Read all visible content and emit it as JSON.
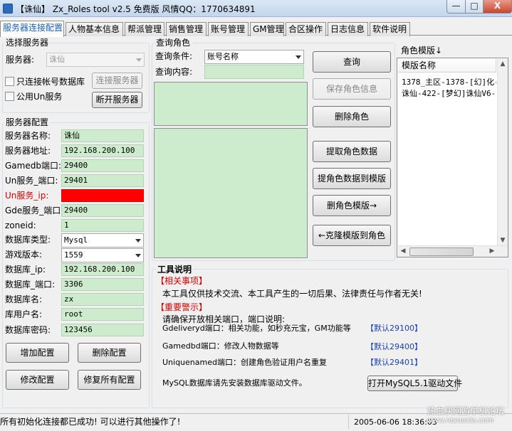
{
  "window": {
    "title": "【诛仙】 Zx_Roles tool v2.5 免费版 风情QQ：1770634891",
    "min": "—",
    "max": "□",
    "close": "X"
  },
  "tabs": [
    "服务器连接配置",
    "人物基本信息",
    "帮派管理",
    "销售管理",
    "账号管理",
    "GM管理",
    "合区操作",
    "日志信息",
    "软件说明"
  ],
  "server_select": {
    "group_label": "选择服务器",
    "server_label": "服务器:",
    "server_value": "诛仙",
    "only_account_db": "只连接帐号数据库",
    "public_un": "公用Un服务",
    "connect_button": "连接服务器",
    "disconnect_button": "断开服务器"
  },
  "server_config": {
    "group_label": "服务器配置",
    "fields": [
      {
        "label": "服务器名称:",
        "value": "诛仙"
      },
      {
        "label": "服务器地址:",
        "value": "192.168.200.100"
      },
      {
        "label": "Gamedb端口:",
        "value": "29400"
      },
      {
        "label": "Un服务_端口:",
        "value": "29401"
      },
      {
        "label": "Un服务_ip:",
        "value": ""
      },
      {
        "label": "Gde服务_端口:",
        "value": "29400"
      },
      {
        "label": "zoneid:",
        "value": "1"
      },
      {
        "label": "数据库类型:",
        "value": "Mysql"
      },
      {
        "label": "游戏版本:",
        "value": "1559"
      },
      {
        "label": "数据库_ip:",
        "value": "192.168.200.100"
      },
      {
        "label": "数据库_端口:",
        "value": "3306"
      },
      {
        "label": "数据库名:",
        "value": "zx"
      },
      {
        "label": "库用户名:",
        "value": "root"
      },
      {
        "label": "数据库密码:",
        "value": "123456"
      }
    ],
    "add_button": "增加配置",
    "delete_button": "删除配置",
    "modify_button": "修改配置",
    "restore_button": "修复所有配置"
  },
  "query": {
    "group_label": "查询角色",
    "condition_label": "查询条件:",
    "condition_value": "账号名称",
    "content_label": "查询内容:",
    "content_value": "",
    "query_button": "查询",
    "save_button": "保存角色信息",
    "delete_button": "删除角色",
    "extract_button": "提取角色数据",
    "to_template_button": "提角色数据到模版",
    "delete_template_button": "删角色模版→",
    "clone_button": "←克隆模版到角色"
  },
  "template": {
    "label": "角色模版↓",
    "column": "模版名称",
    "items": [
      "1378_主区-1378-[幻]化-1041",
      "诛仙-422-[梦幻]诛仙V6-2112"
    ]
  },
  "tool_info": {
    "title": "工具说明",
    "notice_title": "【相关事项】",
    "notice_text": "本工具仅供技术交流、本工具产生的一切后果、法律责任与作者无关!",
    "warning_title": "【重要警示】",
    "port_intro": "请确保开放相关端口，端口说明:",
    "port_lines": [
      {
        "text": "Gdeliveryd端口：相关功能，如秒充元宝，GM功能等",
        "default": "【默认29100】"
      },
      {
        "text": "Gamedbd端口：修改人物数据等",
        "default": "【默认29400】"
      },
      {
        "text": "Uniquenamed端口：创建角色验证用户名重复",
        "default": "【默认29401】"
      }
    ],
    "mysql_text": "MySQL数据库请先安装数据库驱动文件。",
    "mysql_button": "打开MySQL5.1驱动文件"
  },
  "status": {
    "message": "所有初始化连接都已成功! 可以进行其他操作了!",
    "datetime": "2005-06-06  18:36:03",
    "watermark": "热血侠网游单机论坛",
    "watermark_url": "www.rexuexia.com"
  },
  "colors": {
    "field_green": "#cdeccd",
    "error_red": "#ff0000",
    "tab_active": "#1a5fb4"
  }
}
